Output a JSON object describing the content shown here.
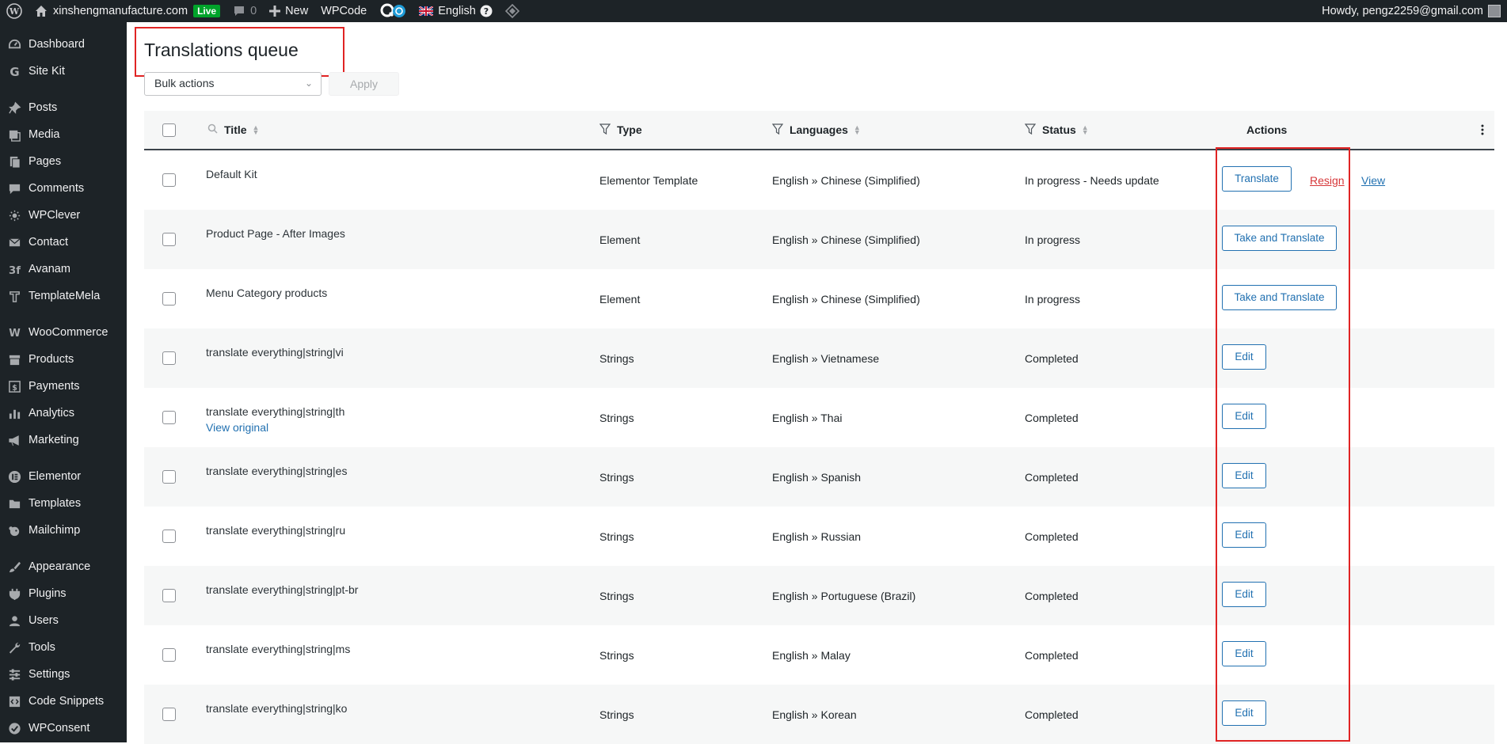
{
  "adminbar": {
    "site": "xinshengmanufacture.com",
    "live": "Live",
    "comments": "0",
    "new": "New",
    "wpcode": "WPCode",
    "language": "English",
    "howdy": "Howdy, pengz2259@gmail.com"
  },
  "sidebar": {
    "items": [
      {
        "label": "Dashboard",
        "icon": "dashboard-icon"
      },
      {
        "label": "Site Kit",
        "icon": "google-icon"
      },
      {
        "label": "Posts",
        "icon": "pin-icon"
      },
      {
        "label": "Media",
        "icon": "media-icon"
      },
      {
        "label": "Pages",
        "icon": "pages-icon"
      },
      {
        "label": "Comments",
        "icon": "comment-icon"
      },
      {
        "label": "WPClever",
        "icon": "wpclever-icon"
      },
      {
        "label": "Contact",
        "icon": "mail-icon"
      },
      {
        "label": "Avanam",
        "icon": "avanam-icon"
      },
      {
        "label": "TemplateMela",
        "icon": "templatemela-icon"
      },
      {
        "label": "WooCommerce",
        "icon": "woocommerce-icon"
      },
      {
        "label": "Products",
        "icon": "archive-icon"
      },
      {
        "label": "Payments",
        "icon": "dollar-icon"
      },
      {
        "label": "Analytics",
        "icon": "bar-chart-icon"
      },
      {
        "label": "Marketing",
        "icon": "megaphone-icon"
      },
      {
        "label": "Elementor",
        "icon": "elementor-icon"
      },
      {
        "label": "Templates",
        "icon": "folder-icon"
      },
      {
        "label": "Mailchimp",
        "icon": "mailchimp-icon"
      },
      {
        "label": "Appearance",
        "icon": "brush-icon"
      },
      {
        "label": "Plugins",
        "icon": "plug-icon"
      },
      {
        "label": "Users",
        "icon": "user-icon"
      },
      {
        "label": "Tools",
        "icon": "wrench-icon"
      },
      {
        "label": "Settings",
        "icon": "settings-icon"
      },
      {
        "label": "Code Snippets",
        "icon": "code-icon"
      },
      {
        "label": "WPConsent",
        "icon": "consent-icon"
      }
    ]
  },
  "page": {
    "title": "Translations queue",
    "bulk_actions": "Bulk actions",
    "apply": "Apply"
  },
  "table": {
    "headers": {
      "title": "Title",
      "type": "Type",
      "languages": "Languages",
      "status": "Status",
      "actions": "Actions"
    },
    "rows": [
      {
        "title": "Default Kit",
        "type": "Elementor Template",
        "languages": "English » Chinese (Simplified)",
        "status": "In progress - Needs update",
        "action": "Translate",
        "resign": "Resign",
        "view": "View"
      },
      {
        "title": "Product Page - After Images",
        "type": "Element",
        "languages": "English » Chinese (Simplified)",
        "status": "In progress",
        "action": "Take and Translate"
      },
      {
        "title": "Menu Category products",
        "type": "Element",
        "languages": "English » Chinese (Simplified)",
        "status": "In progress",
        "action": "Take and Translate"
      },
      {
        "title": "translate everything|string|vi",
        "type": "Strings",
        "languages": "English » Vietnamese",
        "status": "Completed",
        "action": "Edit"
      },
      {
        "title": "translate everything|string|th",
        "view_original": "View original",
        "type": "Strings",
        "languages": "English » Thai",
        "status": "Completed",
        "action": "Edit"
      },
      {
        "title": "translate everything|string|es",
        "type": "Strings",
        "languages": "English » Spanish",
        "status": "Completed",
        "action": "Edit"
      },
      {
        "title": "translate everything|string|ru",
        "type": "Strings",
        "languages": "English » Russian",
        "status": "Completed",
        "action": "Edit"
      },
      {
        "title": "translate everything|string|pt-br",
        "type": "Strings",
        "languages": "English » Portuguese (Brazil)",
        "status": "Completed",
        "action": "Edit"
      },
      {
        "title": "translate everything|string|ms",
        "type": "Strings",
        "languages": "English » Malay",
        "status": "Completed",
        "action": "Edit"
      },
      {
        "title": "translate everything|string|ko",
        "type": "Strings",
        "languages": "English » Korean",
        "status": "Completed",
        "action": "Edit"
      }
    ]
  },
  "colors": {
    "accent": "#2271b1",
    "resign": "#d63638",
    "annotation": "#e02424"
  }
}
